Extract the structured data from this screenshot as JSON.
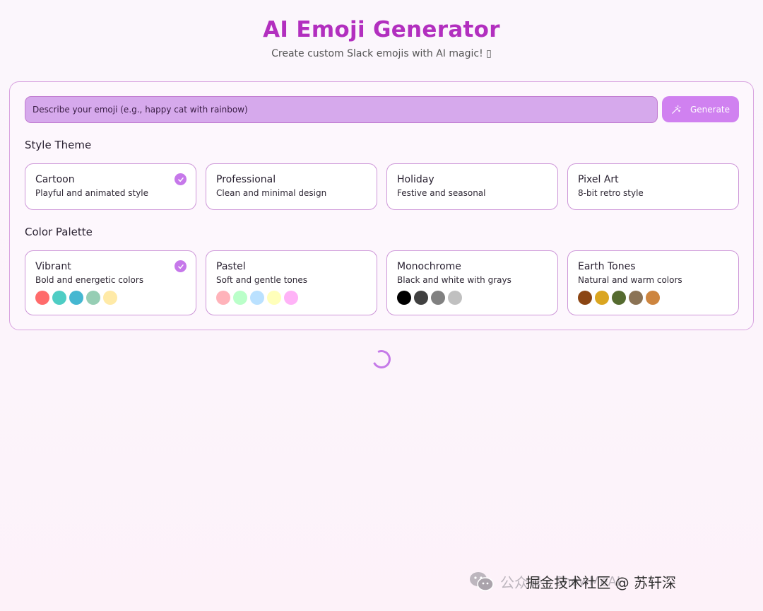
{
  "header": {
    "title": "AI Emoji Generator",
    "subtitle": "Create custom Slack emojis with AI magic! ▯"
  },
  "prompt": {
    "placeholder": "Describe your emoji (e.g., happy cat with rainbow)",
    "value": "",
    "icon": "magic-wand-icon",
    "button_label": "Generate"
  },
  "style_theme": {
    "label": "Style Theme",
    "options": [
      {
        "name": "Cartoon",
        "description": "Playful and animated style",
        "selected": true
      },
      {
        "name": "Professional",
        "description": "Clean and minimal design",
        "selected": false
      },
      {
        "name": "Holiday",
        "description": "Festive and seasonal",
        "selected": false
      },
      {
        "name": "Pixel Art",
        "description": "8-bit retro style",
        "selected": false
      }
    ]
  },
  "color_palette": {
    "label": "Color Palette",
    "options": [
      {
        "name": "Vibrant",
        "description": "Bold and energetic colors",
        "selected": true,
        "colors": [
          "#ff6b6b",
          "#4ecdc4",
          "#45b7d1",
          "#96ceb4",
          "#ffeaa7"
        ]
      },
      {
        "name": "Pastel",
        "description": "Soft and gentle tones",
        "selected": false,
        "colors": [
          "#ffb3ba",
          "#baffc9",
          "#bae1ff",
          "#ffffba",
          "#ffb3f7"
        ]
      },
      {
        "name": "Monochrome",
        "description": "Black and white with grays",
        "selected": false,
        "colors": [
          "#000000",
          "#404040",
          "#808080",
          "#c0c0c0",
          "#ffffff"
        ]
      },
      {
        "name": "Earth Tones",
        "description": "Natural and warm colors",
        "selected": false,
        "colors": [
          "#8b4513",
          "#daa520",
          "#556b2f",
          "#8b7355",
          "#cd853f"
        ]
      }
    ]
  },
  "status": {
    "loading": true,
    "icon": "loading-spinner-icon"
  },
  "theme": {
    "accent": "#b22fbf",
    "button": "#d081f0",
    "border": "#d8a3e0"
  },
  "watermark": {
    "icon": "wechat-icon",
    "part1": "公众号",
    "part2": "· ShowMeAI",
    "part3": "掘金技术社区 @ 苏轩深"
  }
}
